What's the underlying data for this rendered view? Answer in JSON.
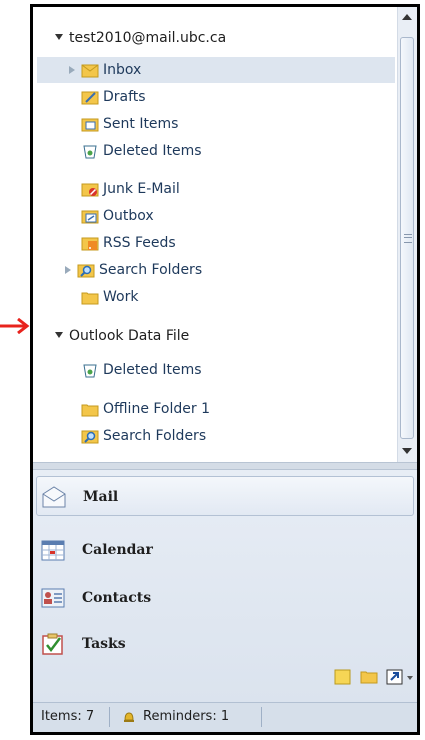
{
  "accounts": [
    {
      "name": "test2010@mail.ubc.ca",
      "folders": [
        {
          "label": "Inbox",
          "icon": "inbox-icon",
          "selected": true
        },
        {
          "label": "Drafts",
          "icon": "drafts-icon"
        },
        {
          "label": "Sent Items",
          "icon": "sent-items-icon"
        },
        {
          "label": "Deleted Items",
          "icon": "deleted-items-icon"
        },
        {
          "label": "Junk E-Mail",
          "icon": "junk-email-icon"
        },
        {
          "label": "Outbox",
          "icon": "outbox-icon"
        },
        {
          "label": "RSS Feeds",
          "icon": "rss-feeds-icon"
        },
        {
          "label": "Search Folders",
          "icon": "search-folders-icon"
        },
        {
          "label": "Work",
          "icon": "folder-icon"
        }
      ]
    },
    {
      "name": "Outlook Data File",
      "folders": [
        {
          "label": "Deleted Items",
          "icon": "deleted-items-icon"
        },
        {
          "label": "Offline Folder 1",
          "icon": "folder-icon"
        },
        {
          "label": "Search Folders",
          "icon": "search-folders-icon"
        }
      ]
    }
  ],
  "nav": {
    "mail": "Mail",
    "calendar": "Calendar",
    "contacts": "Contacts",
    "tasks": "Tasks",
    "active": "Mail"
  },
  "status": {
    "items": "Items: 7",
    "reminders": "Reminders: 1"
  },
  "colors": {
    "selection": "#dde5ef",
    "arrow": "#e8231d",
    "folder": "#f3c64a"
  }
}
